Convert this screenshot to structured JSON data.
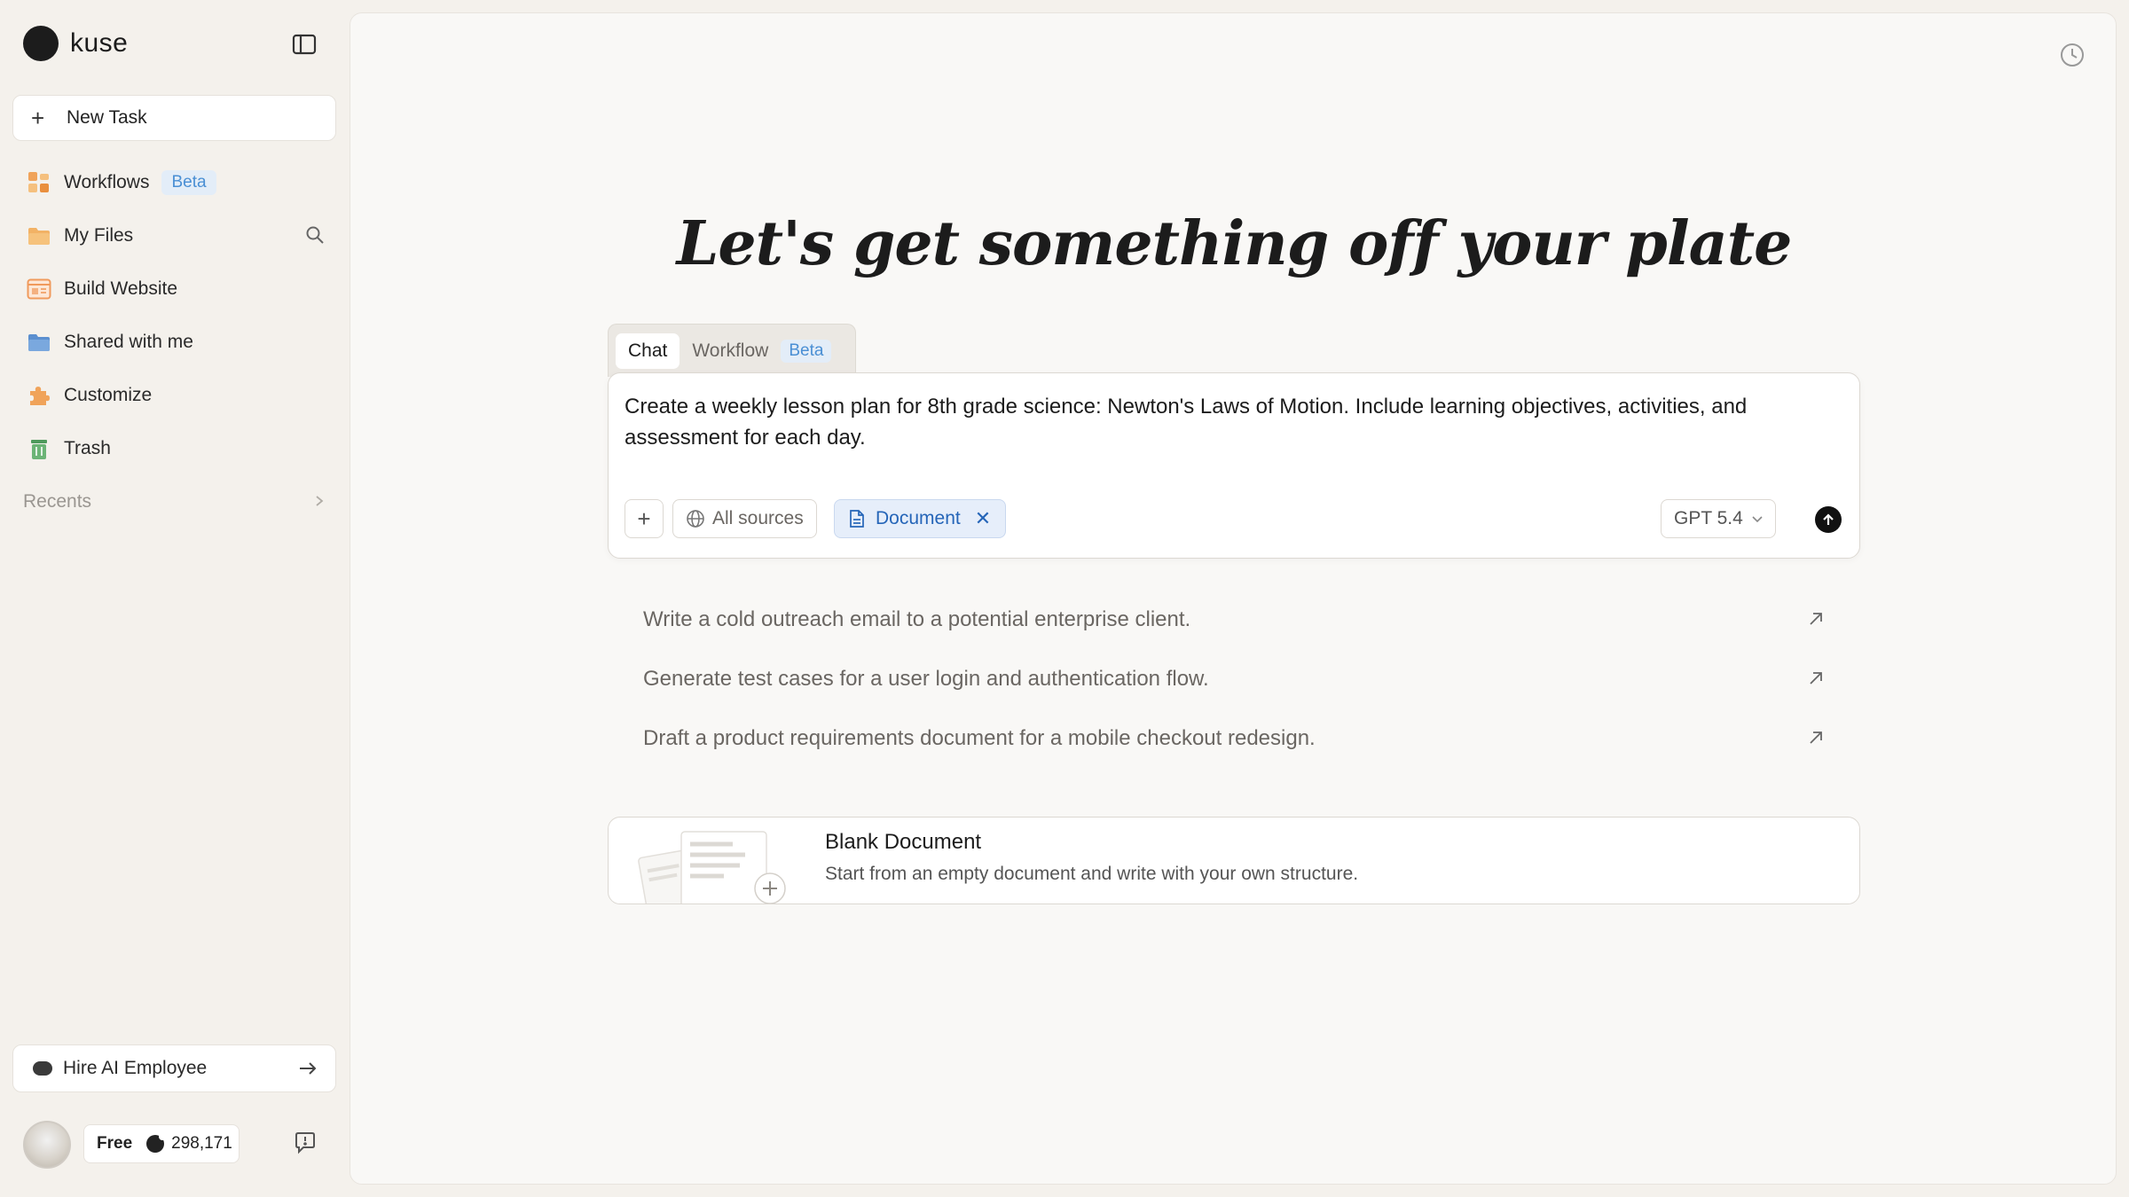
{
  "brand": {
    "name": "kuse"
  },
  "sidebar": {
    "new_task": "New Task",
    "items": [
      {
        "label": "Workflows",
        "badge": "Beta",
        "icon": "workflows-icon"
      },
      {
        "label": "My Files",
        "icon": "folder-icon"
      },
      {
        "label": "Build Website",
        "icon": "website-icon"
      },
      {
        "label": "Shared with me",
        "icon": "shared-folder-icon"
      },
      {
        "label": "Customize",
        "icon": "puzzle-icon"
      },
      {
        "label": "Trash",
        "icon": "trash-icon"
      }
    ],
    "recents_label": "Recents",
    "hire_label": "Hire AI Employee",
    "plan": {
      "tier": "Free",
      "credits": "298,171"
    }
  },
  "main": {
    "headline": "Let's get something off your plate",
    "tabs": [
      {
        "label": "Chat"
      },
      {
        "label": "Workflow",
        "badge": "Beta"
      }
    ],
    "composer": {
      "prompt": "Create a weekly lesson plan for 8th grade science: Newton's Laws of Motion. Include learning objectives, activities, and assessment for each day.",
      "sources_label": "All sources",
      "chip_label": "Document",
      "model_label": "GPT 5.4"
    },
    "suggestions": [
      "Write a cold outreach email to a potential enterprise client.",
      "Generate test cases for a user login and authentication flow.",
      "Draft a product requirements document for a mobile checkout redesign."
    ],
    "blank_card": {
      "title": "Blank Document",
      "subtitle": "Start from an empty document and write with your own structure."
    }
  },
  "colors": {
    "accent_blue": "#4a8fd4",
    "chip_blue": "#2565b8",
    "workflows_orange": "#f0a35a",
    "folder_orange": "#f2b265",
    "shared_blue": "#6e9fd6",
    "trash_green": "#5fa86a"
  }
}
